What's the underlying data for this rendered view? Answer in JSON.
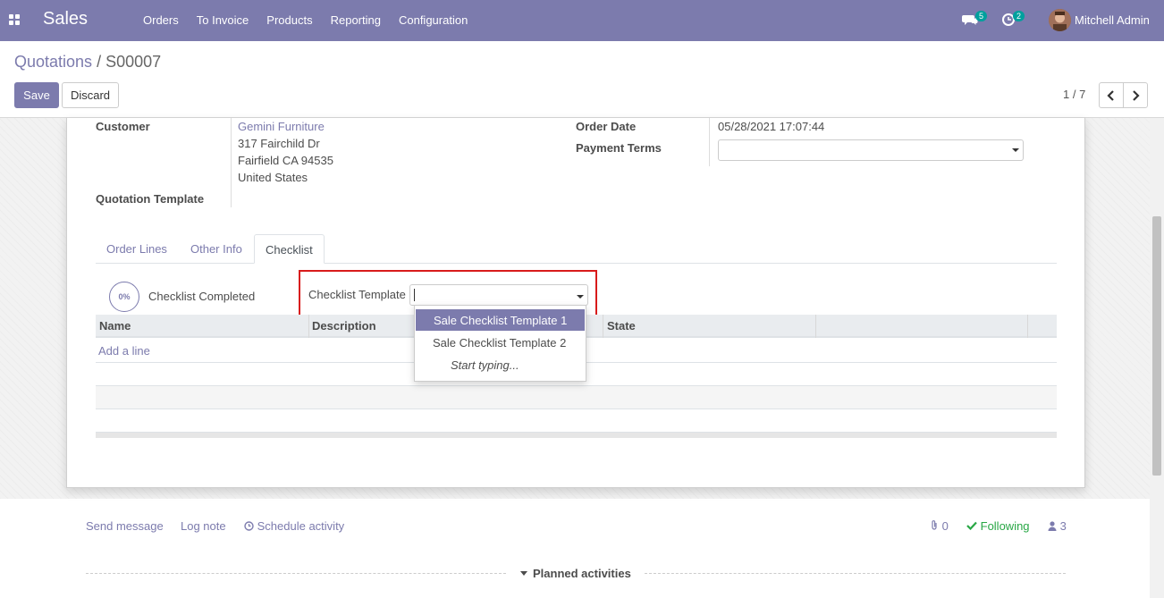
{
  "navbar": {
    "app_name": "Sales",
    "menu": [
      "Orders",
      "To Invoice",
      "Products",
      "Reporting",
      "Configuration"
    ],
    "messages_count": "5",
    "activities_count": "2",
    "user_name": "Mitchell Admin",
    "color": "#7c7bad"
  },
  "breadcrumb": {
    "parent": "Quotations",
    "separator": "/",
    "current": "S00007"
  },
  "buttons": {
    "save": "Save",
    "discard": "Discard"
  },
  "pager": {
    "value": "1 / 7"
  },
  "form": {
    "customer_label": "Customer",
    "customer_name": "Gemini Furniture",
    "customer_street": "317 Fairchild Dr",
    "customer_city": "Fairfield CA 94535",
    "customer_country": "United States",
    "quotation_template_label": "Quotation Template",
    "order_date_label": "Order Date",
    "order_date_value": "05/28/2021 17:07:44",
    "payment_terms_label": "Payment Terms",
    "payment_terms_value": ""
  },
  "tabs": [
    "Order Lines",
    "Other Info",
    "Checklist"
  ],
  "checklist": {
    "progress": "0%",
    "completed_label": "Checklist Completed",
    "template_label": "Checklist Template",
    "template_value": "",
    "columns": [
      "Name",
      "Description",
      "State"
    ],
    "add_line": "Add a line",
    "dropdown_options": [
      "Sale Checklist Template 1",
      "Sale Checklist Template 2"
    ],
    "dropdown_hint": "Start typing..."
  },
  "chatter": {
    "send_message": "Send message",
    "log_note": "Log note",
    "schedule_activity": "Schedule activity",
    "attachments": "0",
    "following": "Following",
    "followers": "3",
    "planned_activities": "Planned activities"
  }
}
